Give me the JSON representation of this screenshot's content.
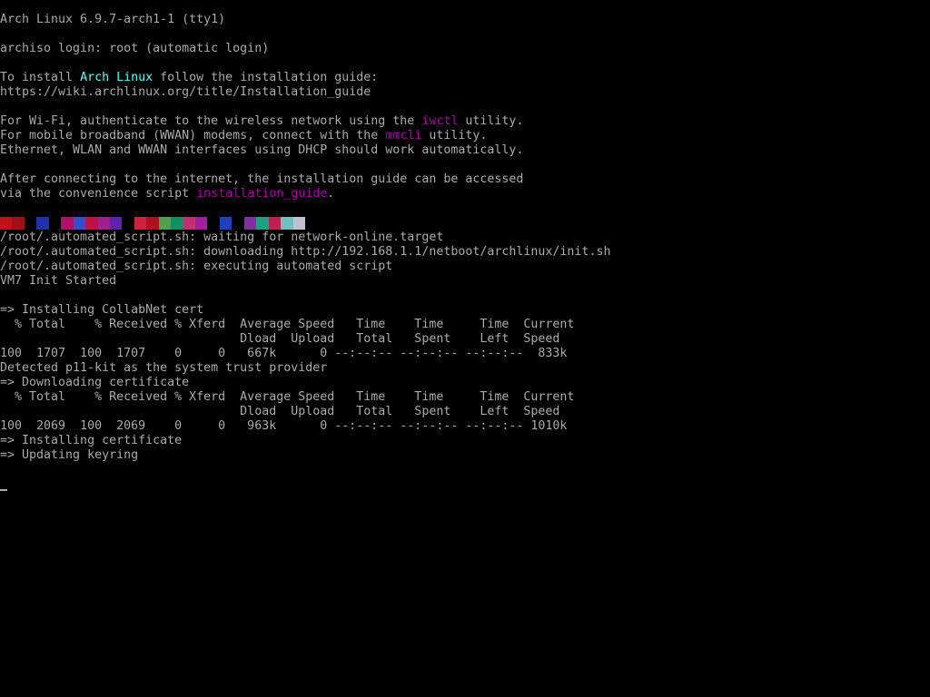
{
  "terminal": {
    "banner": "Arch Linux 6.9.7-arch1-1 (tty1)",
    "login": "archiso login: root (automatic login)",
    "install": {
      "prefix": "To install ",
      "highlight": "Arch Linux",
      "suffix": " follow the installation guide:",
      "url": "https://wiki.archlinux.org/title/Installation_guide"
    },
    "wifi": {
      "prefix": "For Wi-Fi, authenticate to the wireless network using the ",
      "highlight": "iwctl",
      "suffix": " utility."
    },
    "wwan": {
      "prefix": "For mobile broadband (WWAN) modems, connect with the ",
      "highlight": "mmcli",
      "suffix": " utility."
    },
    "ethernet": "Ethernet, WLAN and WWAN interfaces using DHCP should work automatically.",
    "after1": "After connecting to the internet, the installation guide can be accessed",
    "after2": {
      "prefix": "via the convenience script ",
      "highlight": "installation_guide",
      "suffix": "."
    },
    "noise_colors": [
      "#c0101a",
      "#a01018",
      "#000000",
      "#2030b0",
      "#000000",
      "#b0106a",
      "#3050d0",
      "#c0104a",
      "#a02090",
      "#6020b0",
      "#000000",
      "#d02040",
      "#b01020",
      "#50a050",
      "#109060",
      "#c03070",
      "#a020a0",
      "#000000",
      "#2040c0",
      "#000000",
      "#8030a0",
      "#20a080",
      "#c02050",
      "#70c0c0",
      "#c0c0d0"
    ],
    "script_lines": [
      "/root/.automated_script.sh: waiting for network-online.target",
      "/root/.automated_script.sh: downloading http://192.168.1.1/netboot/archlinux/init.sh",
      "/root/.automated_script.sh: executing automated script",
      "VM7 Init Started"
    ],
    "collab": [
      "=> Installing CollabNet cert",
      "  % Total    % Received % Xferd  Average Speed   Time    Time     Time  Current",
      "                                 Dload  Upload   Total   Spent    Left  Speed",
      "100  1707  100  1707    0     0   667k      0 --:--:-- --:--:-- --:--:--  833k",
      "Detected p11-kit as the system trust provider",
      "=> Downloading certificate",
      "  % Total    % Received % Xferd  Average Speed   Time    Time     Time  Current",
      "                                 Dload  Upload   Total   Spent    Left  Speed",
      "100  2069  100  2069    0     0   963k      0 --:--:-- --:--:-- --:--:-- 1010k",
      "=> Installing certificate",
      "=> Updating keyring"
    ]
  }
}
